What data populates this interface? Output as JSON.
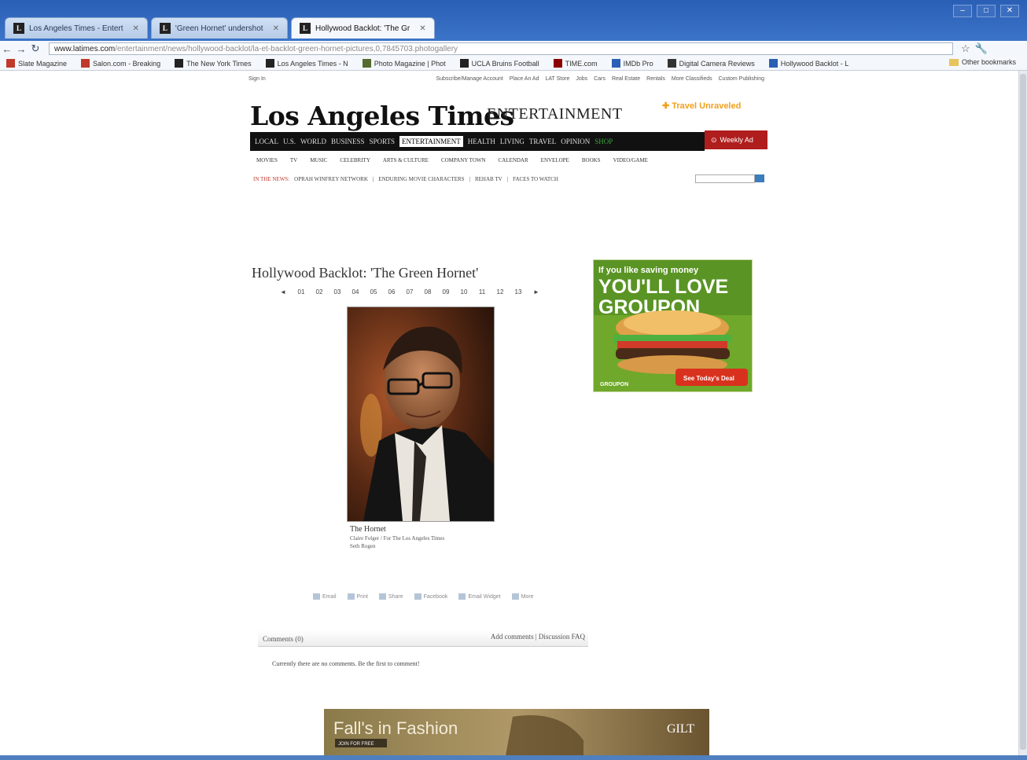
{
  "browser": {
    "tabs": [
      {
        "label": "Los Angeles Times - Entert",
        "active": false
      },
      {
        "label": "'Green Hornet' undershot",
        "active": false
      },
      {
        "label": "Hollywood Backlot: 'The Gr",
        "active": true
      }
    ],
    "window_controls": [
      "–",
      "□",
      "✕"
    ],
    "url_host": "www.latimes.com",
    "url_path": "/entertainment/news/hollywood-backlot/la-et-backlot-green-hornet-pictures,0,7845703.photogallery",
    "bookmarks": [
      {
        "label": "Slate Magazine",
        "color": "#c0392b"
      },
      {
        "label": "Salon.com - Breaking",
        "color": "#c0392b"
      },
      {
        "label": "The New York Times",
        "color": "#222222"
      },
      {
        "label": "Los Angeles Times - N",
        "color": "#222222"
      },
      {
        "label": "Photo Magazine | Phot",
        "color": "#556b2f"
      },
      {
        "label": "UCLA Bruins Football",
        "color": "#222222"
      },
      {
        "label": "TIME.com",
        "color": "#8b0000"
      },
      {
        "label": "IMDb Pro",
        "color": "#2a5fb5"
      },
      {
        "label": "Digital Camera Reviews",
        "color": "#333333"
      },
      {
        "label": "Hollywood Backlot - L",
        "color": "#2a5fb5"
      }
    ],
    "other_bookmarks": "Other bookmarks"
  },
  "header": {
    "utility_left": "Sign In",
    "utility_links": [
      "Subscribe/Manage Account",
      "Place An Ad",
      "LAT Store",
      "Jobs",
      "Cars",
      "Real Estate",
      "Rentals",
      "More Classifieds",
      "Custom Publishing"
    ],
    "logo": "Los Angeles Times",
    "section": "ENTERTAINMENT",
    "promo": "Travel Unraveled",
    "main_nav": [
      "LOCAL",
      "U.S.",
      "WORLD",
      "BUSINESS",
      "SPORTS",
      "ENTERTAINMENT",
      "HEALTH",
      "LIVING",
      "TRAVEL",
      "OPINION",
      "SHOP"
    ],
    "active_nav": "ENTERTAINMENT",
    "weekly_ad": "Weekly Ad",
    "sub_nav": [
      "MOVIES",
      "TV",
      "MUSIC",
      "CELEBRITY",
      "ARTS & CULTURE",
      "COMPANY TOWN",
      "CALENDAR",
      "ENVELOPE",
      "BOOKS",
      "VIDEO/GAME"
    ],
    "trending_label": "IN THE NEWS:",
    "trending": [
      "OPRAH WINFREY NETWORK",
      "ENDURING MOVIE CHARACTERS",
      "REHAB TV",
      "FACES TO WATCH"
    ]
  },
  "gallery": {
    "title": "Hollywood Backlot: 'The Green Hornet'",
    "pager": [
      "◄",
      "01",
      "02",
      "03",
      "04",
      "05",
      "06",
      "07",
      "08",
      "09",
      "10",
      "11",
      "12",
      "13",
      "►"
    ],
    "caption_title": "The Hornet",
    "caption_credit": "Claire Folger / For The Los Angeles Times",
    "caption_line3": "Seth Rogen"
  },
  "ad": {
    "line1": "If you like saving money",
    "line2": "YOU'LL LOVE",
    "line3": "GROUPON",
    "cta": "See Today's Deal",
    "brand": "GROUPON"
  },
  "share": [
    "Email",
    "Print",
    "Share",
    "Facebook",
    "Email Widget",
    "More"
  ],
  "comments": {
    "label": "Comments (0)",
    "actions": "Add comments | Discussion FAQ",
    "empty": "Currently there are no comments. Be the first to comment!"
  },
  "banner": {
    "headline": "Fall's in Fashion",
    "sub": "JOIN FOR FREE",
    "brand": "GILT"
  }
}
